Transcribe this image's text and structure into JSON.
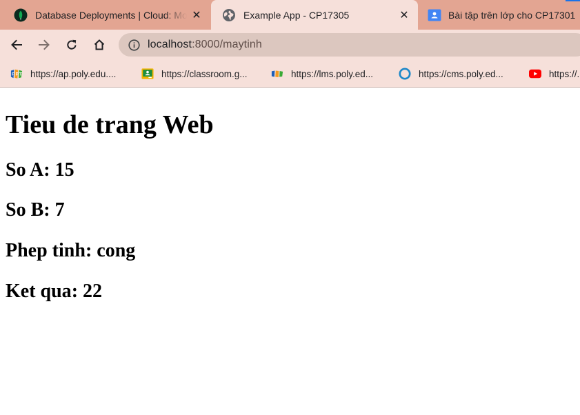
{
  "browser": {
    "tabs": [
      {
        "title": "Database Deployments | Cloud: MongoDB Cloud",
        "favicon": "mongodb-leaf-icon",
        "active": false
      },
      {
        "title": "Example App - CP17305",
        "favicon": "globe-icon",
        "active": true
      },
      {
        "title": "Bài tập trên lớp cho CP17301",
        "favicon": "google-classroom-icon",
        "active": false
      }
    ],
    "address": {
      "host": "localhost",
      "path": ":8000/maytinh"
    },
    "bookmarks": [
      {
        "label": "https://ap.poly.edu....",
        "icon": "fpt-logo-icon"
      },
      {
        "label": "https://classroom.g...",
        "icon": "google-classroom-icon"
      },
      {
        "label": "https://lms.poly.ed...",
        "icon": "fpt-logo-icon"
      },
      {
        "label": "https://cms.poly.ed...",
        "icon": "cms-ring-icon"
      },
      {
        "label": "https://...",
        "icon": "youtube-icon"
      }
    ]
  },
  "page": {
    "title": "Tieu de trang Web",
    "fields": [
      {
        "label": "So A",
        "value": "15"
      },
      {
        "label": "So B",
        "value": "7"
      },
      {
        "label": "Phep tinh",
        "value": "cong"
      },
      {
        "label": "Ket qua",
        "value": "22"
      }
    ]
  },
  "colors": {
    "tabstrip": "#e3a592",
    "toolbar": "#f6e0da",
    "omnibox": "#dcc7bf",
    "accent": "#1a73e8"
  }
}
